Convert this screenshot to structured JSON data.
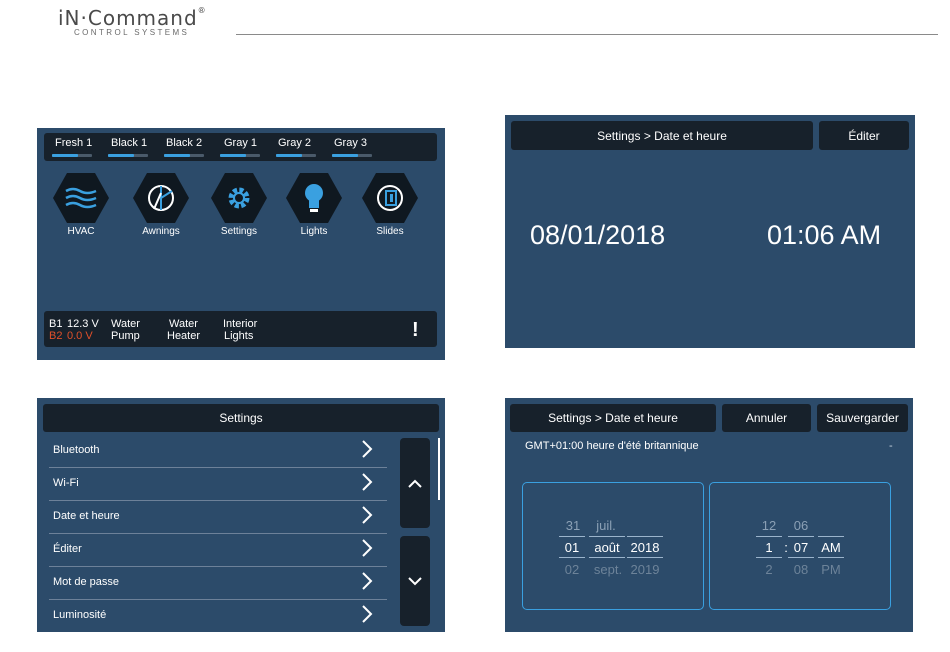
{
  "brand": {
    "logo": "iN·Command",
    "reg": "®",
    "sub": "CONTROL SYSTEMS"
  },
  "home": {
    "tanks": [
      {
        "label": "Fresh 1",
        "level": 0.65
      },
      {
        "label": "Black 1",
        "level": 0.65
      },
      {
        "label": "Black 2",
        "level": 0.65
      },
      {
        "label": "Gray 1",
        "level": 0.65
      },
      {
        "label": "Gray 2",
        "level": 0.65
      },
      {
        "label": "Gray 3",
        "level": 0.65
      }
    ],
    "buttons": [
      {
        "label": "HVAC",
        "icon": "hvac-icon"
      },
      {
        "label": "Awnings",
        "icon": "awning-icon"
      },
      {
        "label": "Settings",
        "icon": "gear-icon"
      },
      {
        "label": "Lights",
        "icon": "bulb-icon"
      },
      {
        "label": "Slides",
        "icon": "slide-icon"
      }
    ],
    "status": {
      "b1_label": "B1",
      "b1_value": "12.3 V",
      "b2_label": "B2",
      "b2_value": "0.0 V",
      "water_pump_1": "Water",
      "water_pump_2": "Pump",
      "water_heater_1": "Water",
      "water_heater_2": "Heater",
      "interior_lights_1": "Interior",
      "interior_lights_2": "Lights",
      "alert": "!"
    }
  },
  "date_view": {
    "breadcrumb": "Settings > Date et heure",
    "edit_button": "Éditer",
    "date": "08/01/2018",
    "time": "01:06 AM"
  },
  "settings_list": {
    "title": "Settings",
    "items": [
      "Bluetooth",
      "Wi-Fi",
      "Date et heure",
      "Éditer",
      "Mot de passe",
      "Luminosité"
    ]
  },
  "date_edit": {
    "breadcrumb": "Settings > Date et heure",
    "cancel_button": "Annuler",
    "save_button": "Sauvergarder",
    "timezone": "GMT+01:00 heure d'été britannique",
    "timezone_dash": "-",
    "date_picker": {
      "day": {
        "prev": "31",
        "selected": "01",
        "next": "02"
      },
      "month": {
        "prev": "juil.",
        "selected": "août",
        "next": "sept."
      },
      "year": {
        "prev": "",
        "selected": "2018",
        "next": "2019"
      }
    },
    "time_picker": {
      "hour": {
        "prev": "12",
        "selected": "1",
        "next": "2"
      },
      "separator": ":",
      "minute": {
        "prev": "06",
        "selected": "07",
        "next": "08"
      },
      "ampm": {
        "prev": "",
        "selected": "AM",
        "next": "PM"
      }
    }
  },
  "colors": {
    "screen_bg": "#2c4b6a",
    "bar_bg": "#17212b",
    "accent": "#3aa0e0",
    "alert_red": "#e0502a"
  }
}
